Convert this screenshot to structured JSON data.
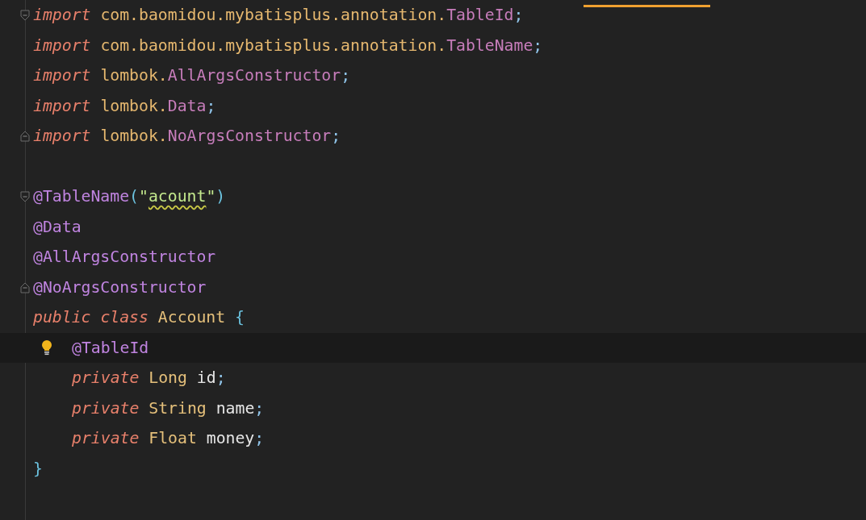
{
  "editor": {
    "lines": [
      {
        "fold_open": true,
        "current": false,
        "tokens": [
          {
            "kind": "keyword",
            "text": "import"
          },
          {
            "kind": "package",
            "text": "com.baomidou.mybatisplus.annotation.",
            "space_before": true
          },
          {
            "kind": "class",
            "text": "TableId"
          },
          {
            "kind": "punct",
            "text": ";"
          }
        ]
      },
      {
        "current": false,
        "tokens": [
          {
            "kind": "keyword",
            "text": "import"
          },
          {
            "kind": "package",
            "text": "com.baomidou.mybatisplus.annotation.",
            "space_before": true
          },
          {
            "kind": "class",
            "text": "TableName"
          },
          {
            "kind": "punct",
            "text": ";"
          }
        ]
      },
      {
        "current": false,
        "tokens": [
          {
            "kind": "keyword",
            "text": "import"
          },
          {
            "kind": "package",
            "text": "lombok.",
            "space_before": true
          },
          {
            "kind": "class",
            "text": "AllArgsConstructor"
          },
          {
            "kind": "punct",
            "text": ";"
          }
        ]
      },
      {
        "current": false,
        "tokens": [
          {
            "kind": "keyword",
            "text": "import"
          },
          {
            "kind": "package",
            "text": "lombok.",
            "space_before": true
          },
          {
            "kind": "class",
            "text": "Data"
          },
          {
            "kind": "punct",
            "text": ";"
          }
        ]
      },
      {
        "fold_close": true,
        "current": false,
        "tokens": [
          {
            "kind": "keyword",
            "text": "import"
          },
          {
            "kind": "package",
            "text": "lombok.",
            "space_before": true
          },
          {
            "kind": "class",
            "text": "NoArgsConstructor"
          },
          {
            "kind": "punct",
            "text": ";"
          }
        ]
      },
      {
        "current": false
      },
      {
        "fold_open": true,
        "current": false,
        "tokens": [
          {
            "kind": "annotation",
            "text": "@TableName"
          },
          {
            "kind": "brace",
            "text": "("
          },
          {
            "kind": "string",
            "text": "\""
          },
          {
            "kind": "string",
            "text": "acount",
            "typo": true
          },
          {
            "kind": "string",
            "text": "\""
          },
          {
            "kind": "brace",
            "text": ")"
          }
        ]
      },
      {
        "current": false,
        "tokens": [
          {
            "kind": "annotation",
            "text": "@Data"
          }
        ]
      },
      {
        "current": false,
        "tokens": [
          {
            "kind": "annotation",
            "text": "@AllArgsConstructor"
          }
        ]
      },
      {
        "fold_close": true,
        "current": false,
        "tokens": [
          {
            "kind": "annotation",
            "text": "@NoArgsConstructor"
          }
        ]
      },
      {
        "current": false,
        "tokens": [
          {
            "kind": "keyword",
            "text": "public"
          },
          {
            "kind": "keyword",
            "text": "class",
            "space_before": true
          },
          {
            "kind": "type",
            "text": "Account",
            "space_before": true
          },
          {
            "kind": "brace",
            "text": "{",
            "space_before": true
          }
        ],
        "children": [
          {
            "current": true,
            "intention": true,
            "tokens": [
              {
                "kind": "annotation",
                "text": "@TableId"
              }
            ]
          },
          {
            "current": false,
            "tokens": [
              {
                "kind": "keyword",
                "text": "private"
              },
              {
                "kind": "type",
                "text": "Long",
                "space_before": true
              },
              {
                "kind": "field",
                "text": "id",
                "space_before": true
              },
              {
                "kind": "punct",
                "text": ";"
              }
            ]
          },
          {
            "current": false,
            "tokens": [
              {
                "kind": "keyword",
                "text": "private"
              },
              {
                "kind": "type",
                "text": "String",
                "space_before": true
              },
              {
                "kind": "field",
                "text": "name",
                "space_before": true
              },
              {
                "kind": "punct",
                "text": ";"
              }
            ]
          },
          {
            "current": false,
            "tokens": [
              {
                "kind": "keyword",
                "text": "private"
              },
              {
                "kind": "type",
                "text": "Float",
                "space_before": true
              },
              {
                "kind": "field",
                "text": "money",
                "space_before": true
              },
              {
                "kind": "punct",
                "text": ";"
              }
            ]
          }
        ]
      },
      {
        "current": false,
        "tokens": [
          {
            "kind": "brace",
            "text": "}"
          }
        ]
      }
    ]
  }
}
